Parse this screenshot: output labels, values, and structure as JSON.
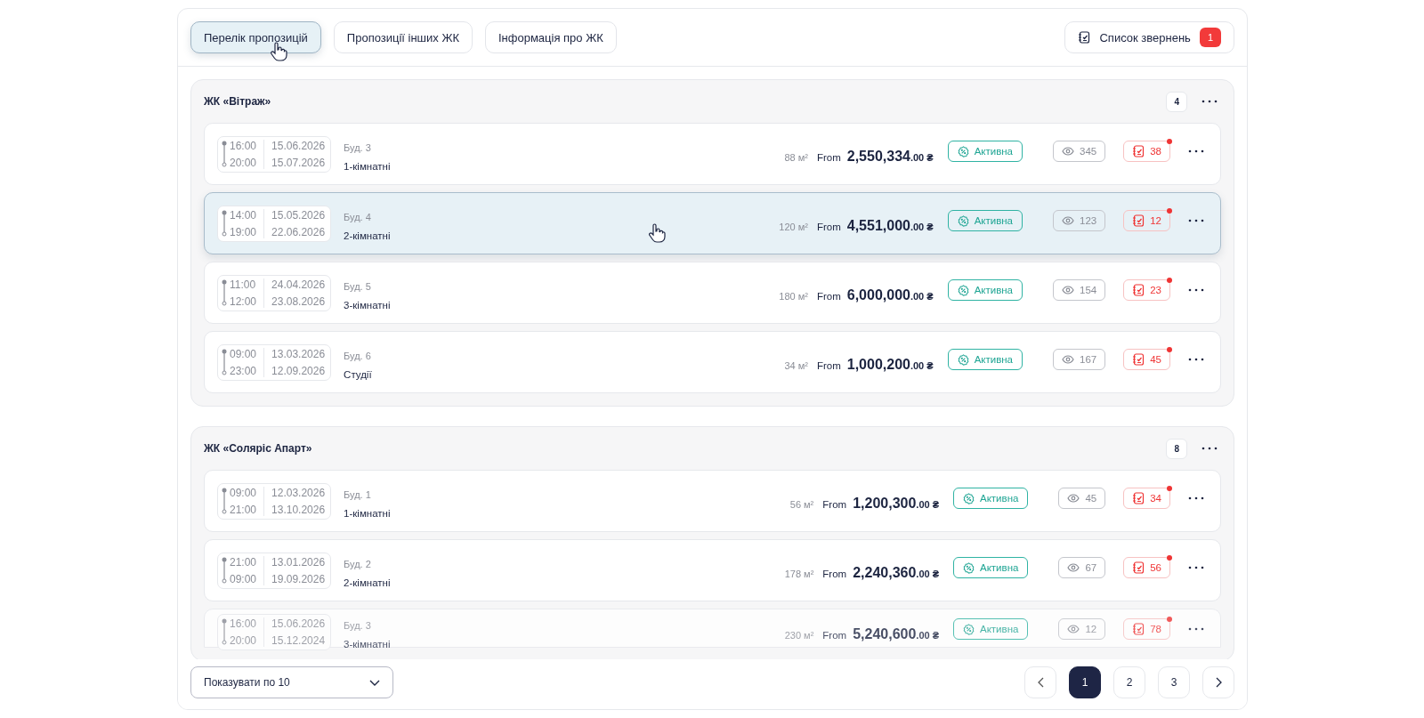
{
  "tabs": [
    {
      "label": "Перелік пропозицій",
      "selected": true
    },
    {
      "label": "Пропозиції інших ЖК",
      "selected": false
    },
    {
      "label": "Інформація про ЖК",
      "selected": false
    }
  ],
  "requests_button": {
    "label": "Список звернень",
    "badge": "1"
  },
  "groups": [
    {
      "title": "ЖК «Вітраж»",
      "count": "4",
      "rows": [
        {
          "time_start": "16:00",
          "date_start": "15.06.2026",
          "time_end": "20:00",
          "date_end": "15.07.2026",
          "building": "Буд. 3",
          "type": "1-кімнатні",
          "area": "88 м²",
          "from": "From",
          "price": "2,550,334",
          "fraction": ".00 ₴",
          "status": "Активна",
          "views": "345",
          "requests": "38",
          "new_requests": true,
          "selected": false,
          "faded": false
        },
        {
          "time_start": "14:00",
          "date_start": "15.05.2026",
          "time_end": "19:00",
          "date_end": "22.06.2026",
          "building": "Буд. 4",
          "type": "2-кімнатні",
          "area": "120 м²",
          "from": "From",
          "price": "4,551,000",
          "fraction": ".00 ₴",
          "status": "Активна",
          "views": "123",
          "requests": "12",
          "new_requests": true,
          "selected": true,
          "faded": false
        },
        {
          "time_start": "11:00",
          "date_start": "24.04.2026",
          "time_end": "12:00",
          "date_end": "23.08.2026",
          "building": "Буд. 5",
          "type": "3-кімнатні",
          "area": "180 м²",
          "from": "From",
          "price": "6,000,000",
          "fraction": ".00 ₴",
          "status": "Активна",
          "views": "154",
          "requests": "23",
          "new_requests": true,
          "selected": false,
          "faded": false
        },
        {
          "time_start": "09:00",
          "date_start": "13.03.2026",
          "time_end": "23:00",
          "date_end": "12.09.2026",
          "building": "Буд. 6",
          "type": "Студії",
          "area": "34 м²",
          "from": "From",
          "price": "1,000,200",
          "fraction": ".00 ₴",
          "status": "Активна",
          "views": "167",
          "requests": "45",
          "new_requests": true,
          "selected": false,
          "faded": false
        }
      ]
    },
    {
      "title": "ЖК «Соляріс Апарт»",
      "count": "8",
      "rows": [
        {
          "time_start": "09:00",
          "date_start": "12.03.2026",
          "time_end": "21:00",
          "date_end": "13.10.2026",
          "building": "Буд. 1",
          "type": "1-кімнатні",
          "area": "56 м²",
          "from": "From",
          "price": "1,200,300",
          "fraction": ".00 ₴",
          "status": "Активна",
          "views": "45",
          "requests": "34",
          "new_requests": true,
          "selected": false,
          "faded": false
        },
        {
          "time_start": "21:00",
          "date_start": "13.01.2026",
          "time_end": "09:00",
          "date_end": "19.09.2026",
          "building": "Буд. 2",
          "type": "2-кімнатні",
          "area": "178 м²",
          "from": "From",
          "price": "2,240,360",
          "fraction": ".00 ₴",
          "status": "Активна",
          "views": "67",
          "requests": "56",
          "new_requests": true,
          "selected": false,
          "faded": false
        },
        {
          "time_start": "16:00",
          "date_start": "15.06.2026",
          "time_end": "20:00",
          "date_end": "15.12.2024",
          "building": "Буд. 3",
          "type": "3-кімнатні",
          "area": "230 м²",
          "from": "From",
          "price": "5,240,600",
          "fraction": ".00 ₴",
          "status": "Активна",
          "views": "12",
          "requests": "78",
          "new_requests": true,
          "selected": false,
          "faded": true
        }
      ]
    }
  ],
  "page_size": {
    "value": "Показувати по 10"
  },
  "pagination": [
    {
      "label": "1",
      "selected": true
    },
    {
      "label": "2",
      "selected": false
    },
    {
      "label": "3",
      "selected": false
    }
  ]
}
